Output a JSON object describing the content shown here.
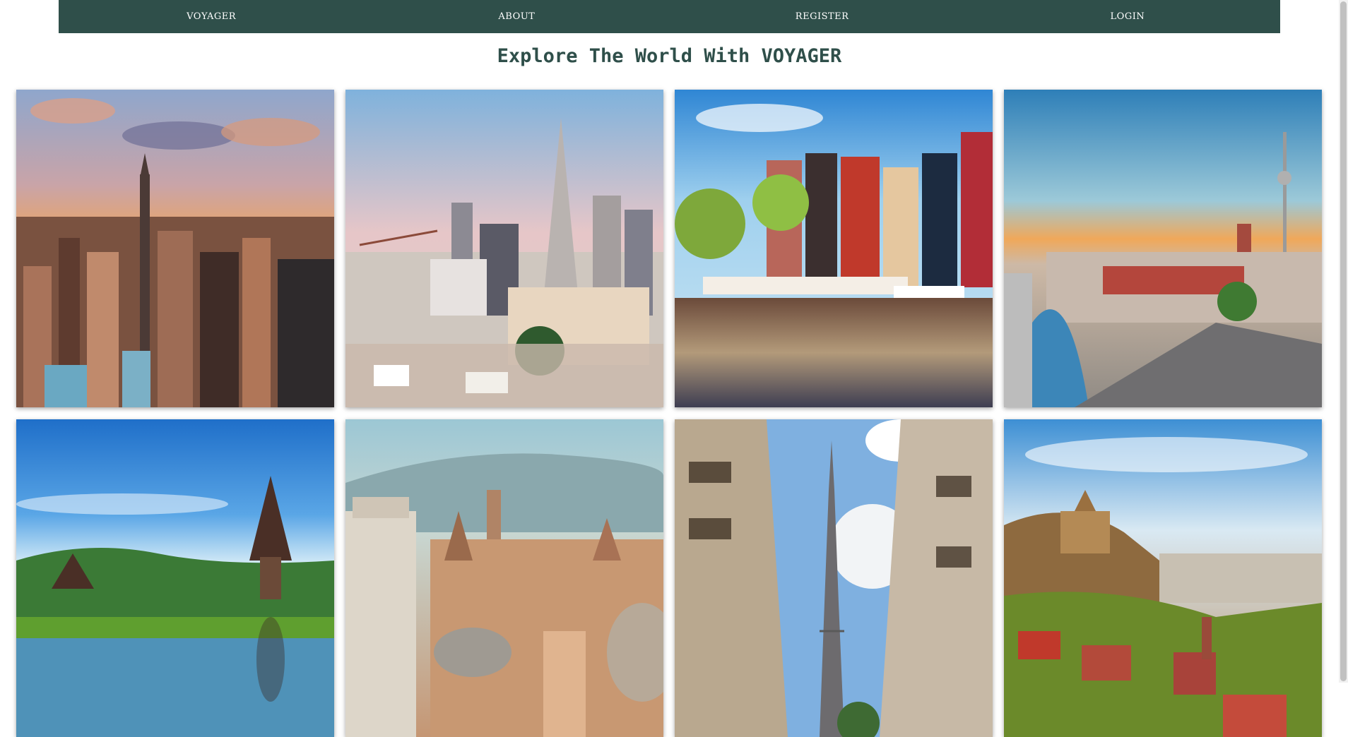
{
  "nav": {
    "items": [
      {
        "label": "VOYAGER"
      },
      {
        "label": "ABOUT"
      },
      {
        "label": "REGISTER"
      },
      {
        "label": "LOGIN"
      }
    ]
  },
  "title": "Explore The World With VOYAGER",
  "colors": {
    "nav_bg": "#2f4f4a",
    "title": "#2f4f4a",
    "nav_text": "#ffffff"
  },
  "gallery": {
    "cards": [
      {
        "subject": "new-york-skyline"
      },
      {
        "subject": "san-francisco-skyline"
      },
      {
        "subject": "amsterdam-canal-houses"
      },
      {
        "subject": "berlin-tv-tower"
      },
      {
        "subject": "bali-water-temple"
      },
      {
        "subject": "rome-rooftops"
      },
      {
        "subject": "paris-eiffel-tower"
      },
      {
        "subject": "tbilisi-old-town"
      }
    ]
  }
}
